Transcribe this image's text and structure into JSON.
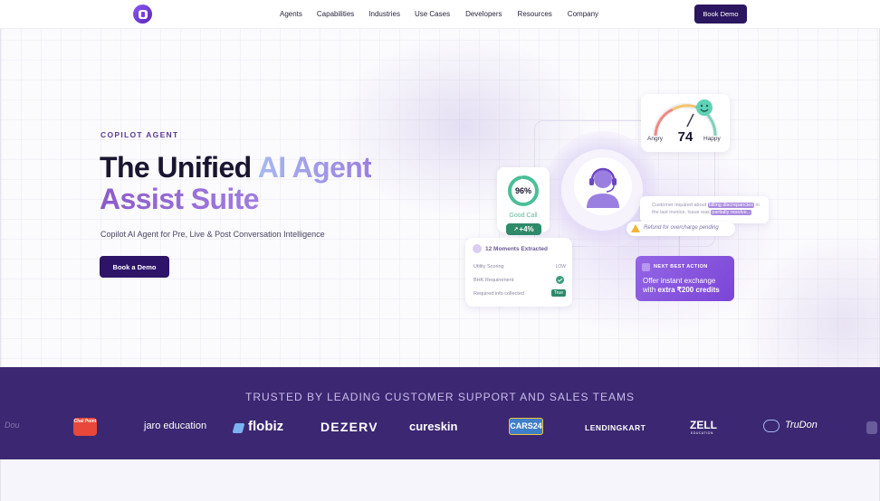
{
  "nav": {
    "links": [
      "Agents",
      "Capabilities",
      "Industries",
      "Use Cases",
      "Developers",
      "Resources",
      "Company"
    ],
    "cta": "Book Demo"
  },
  "hero": {
    "eyebrow": "COPILOT AGENT",
    "headline_dark_1": "The Unified ",
    "headline_accent_1": "AI Agent",
    "headline_accent_2": "Assist Suite",
    "subtitle": "Copilot AI Agent for Pre, Live & Post Conversation Intelligence",
    "cta": "Book a Demo"
  },
  "illustration": {
    "sentiment": {
      "left": "Angry",
      "right": "Happy",
      "score": "74"
    },
    "call_score": {
      "value": "96%",
      "label": "Good Call",
      "delta": "+4%"
    },
    "moments": {
      "title": "12 Moments Extracted",
      "rows": [
        {
          "label": "Utility Scoring",
          "value": "LOW"
        },
        {
          "label": "BHK Requirement",
          "value": ""
        },
        {
          "label": "Required info collected",
          "value": "True"
        }
      ]
    },
    "transcript": {
      "part1": "Customer inquired about ",
      "hl1": "billing discrepancies",
      "part2": " in the last invoice. Issue was ",
      "hl2": "partially resolve..."
    },
    "refund_alert": "Refund for overcharge pending",
    "next_best_action": {
      "label": "NEXT BEST ACTION",
      "line1": "Offer instant exchange",
      "line2_prefix": "with ",
      "line2_bold": "extra ₹200 credits"
    }
  },
  "trusted": {
    "title": "TRUSTED BY LEADING CUSTOMER SUPPORT AND SALES TEAMS",
    "logos": [
      "Dou",
      "Chai Point",
      "jaro education",
      "flobiz",
      "DEZERV",
      "cureskin",
      "CARS24",
      "LENDINGKART",
      "ZELL",
      "TruDon"
    ],
    "zell_sub": "EDUCATION"
  },
  "colors": {
    "brand_dark": "#2e1469",
    "accent": "#8b5cf6",
    "band_bg": "#3b2772",
    "positive": "#2f8a6a"
  }
}
